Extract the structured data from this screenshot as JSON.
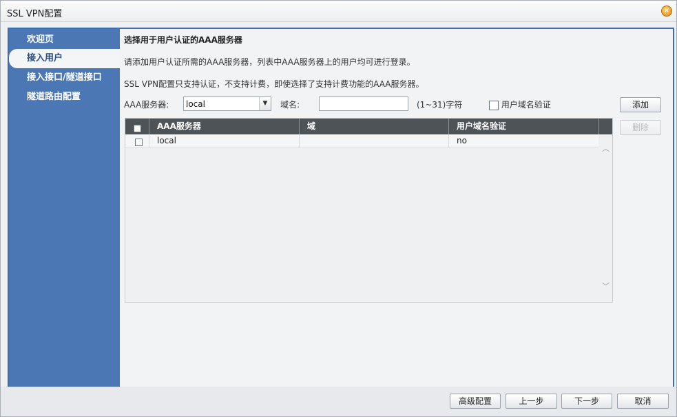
{
  "window": {
    "title": "SSL VPN配置",
    "close_glyph": "×"
  },
  "sidebar": {
    "items": [
      {
        "label": "欢迎页",
        "active": false
      },
      {
        "label": "接入用户",
        "active": true
      },
      {
        "label": "接入接口/隧道接口",
        "active": false
      },
      {
        "label": "隧道路由配置",
        "active": false
      }
    ]
  },
  "content": {
    "section_title": "选择用于用户认证的AAA服务器",
    "desc1": "请添加用户认证所需的AAA服务器，列表中AAA服务器上的用户均可进行登录。",
    "desc2": "SSL VPN配置只支持认证，不支持计费，即使选择了支持计费功能的AAA服务器。",
    "form": {
      "aaa_label": "AAA服务器:",
      "aaa_value": "local",
      "domain_label": "域名:",
      "domain_value": "",
      "domain_hint": "(1~31)字符",
      "domain_verify_label": "用户域名验证"
    },
    "buttons": {
      "add": "添加",
      "delete": "删除"
    },
    "table": {
      "headers": [
        "AAA服务器",
        "域",
        "用户域名验证"
      ],
      "rows": [
        {
          "aaa": "local",
          "domain": "",
          "verify": "no"
        }
      ]
    }
  },
  "footer": {
    "advanced": "高级配置",
    "prev": "上一步",
    "next": "下一步",
    "cancel": "取消"
  },
  "colors": {
    "accent": "#3d6eb3",
    "sidebar_bg": "#4b78b5",
    "table_header_bg": "#4e5358"
  },
  "icons": {
    "close": "close-icon",
    "dropdown": "chevron-down-icon",
    "scroll_up": "chevron-up-icon",
    "scroll_down": "chevron-down-icon"
  }
}
